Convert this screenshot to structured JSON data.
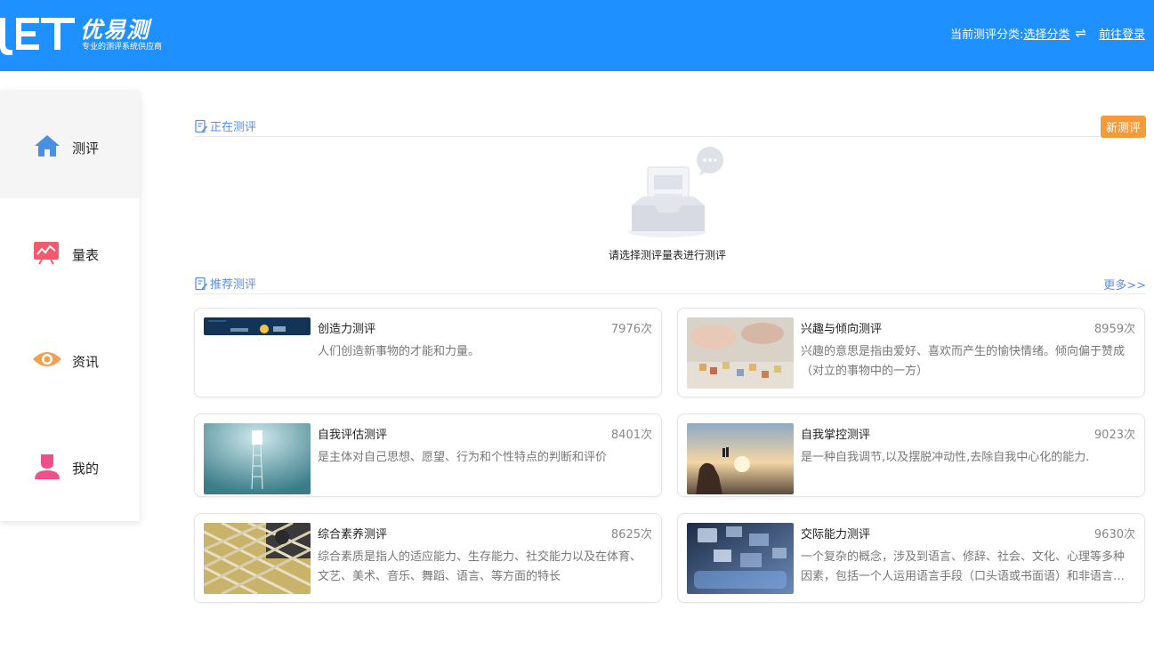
{
  "header": {
    "logo_name": "优易测",
    "logo_slogan": "专业的测评系统供应商",
    "category_label": "当前测评分类:",
    "category_link": "选择分类",
    "login_link": "前往登录"
  },
  "sidebar": {
    "items": [
      {
        "label": "测评",
        "icon": "home-icon",
        "color": "#4a90e2"
      },
      {
        "label": "量表",
        "icon": "chart-board-icon",
        "color": "#f25a6e"
      },
      {
        "label": "资讯",
        "icon": "eye-icon",
        "color": "#f0a050"
      },
      {
        "label": "我的",
        "icon": "user-icon",
        "color": "#f0508a"
      }
    ]
  },
  "current": {
    "title": "正在测评",
    "new_button": "新测评",
    "empty_text": "请选择测评量表进行测评"
  },
  "recommend": {
    "title": "推荐测评",
    "more": "更多>>",
    "cards": [
      {
        "title": "创造力测评",
        "count": "7976次",
        "desc": "人们创造新事物的才能和力量。"
      },
      {
        "title": "兴趣与倾向测评",
        "count": "8959次",
        "desc": "兴趣的意思是指由爱好、喜欢而产生的愉快情绪。倾向偏于赞成（对立的事物中的一方）"
      },
      {
        "title": "自我评估测评",
        "count": "8401次",
        "desc": "是主体对自己思想、愿望、行为和个性特点的判断和评价"
      },
      {
        "title": "自我掌控测评",
        "count": "9023次",
        "desc": "是一种自我调节,以及摆脱冲动性,去除自我中心化的能力."
      },
      {
        "title": "综合素养测评",
        "count": "8625次",
        "desc": "综合素质是指人的适应能力、生存能力、社交能力以及在体育、文艺、美术、音乐、舞蹈、语言、等方面的特长"
      },
      {
        "title": "交际能力测评",
        "count": "9630次",
        "desc": "一个复杂的概念，涉及到语言、修辞、社会、文化、心理等多种因素，包括一个人运用语言手段（口头语或书面语）和非语言手段"
      }
    ]
  },
  "colors": {
    "header_bg": "#1e90ff",
    "accent_blue": "#5b8def",
    "new_button_bg": "#f39b3b"
  }
}
